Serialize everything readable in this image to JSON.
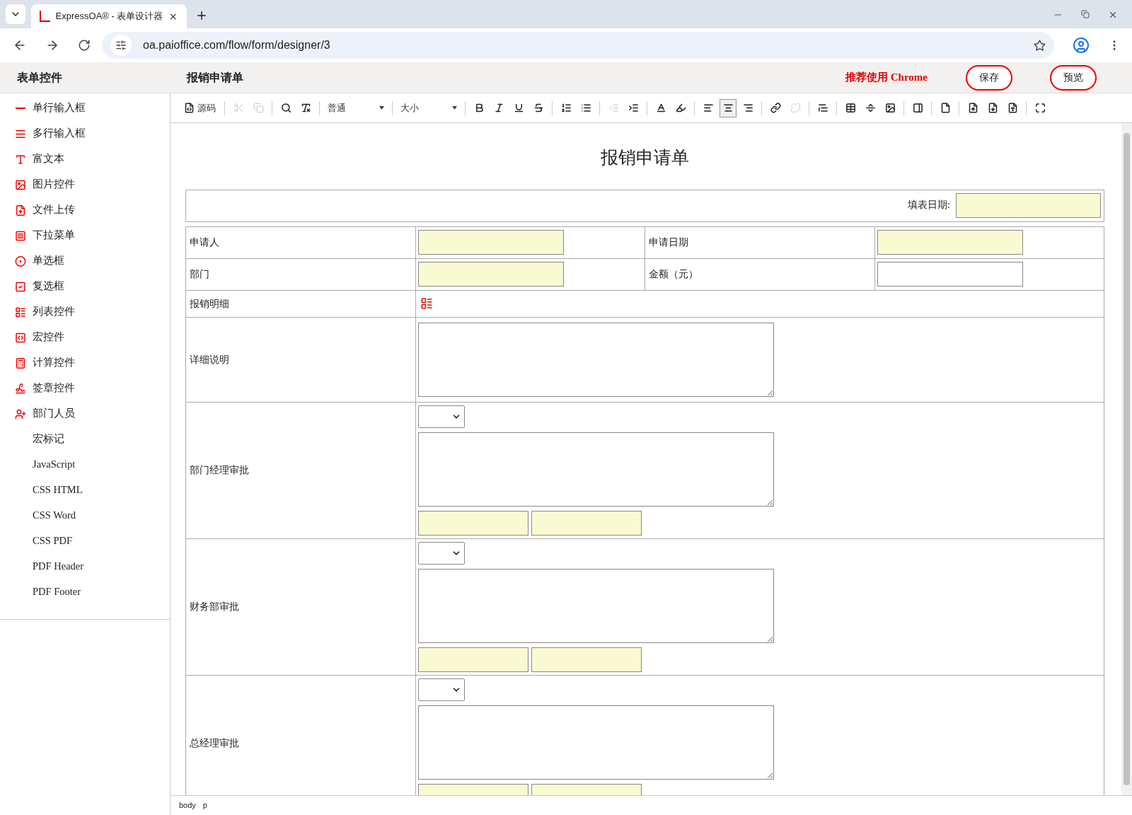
{
  "browser": {
    "tab_title": "ExpressOA® - 表单设计器",
    "url": "oa.paioffice.com/flow/form/designer/3"
  },
  "header": {
    "panel_title": "表单控件",
    "form_title": "报销申请单",
    "notice": "推荐使用 Chrome",
    "buttons": [
      "保存",
      "预览"
    ]
  },
  "sidebar": {
    "items": [
      {
        "label": "单行输入框",
        "kind": "line"
      },
      {
        "label": "多行输入框",
        "kind": "lines"
      },
      {
        "label": "富文本",
        "kind": "richtext"
      },
      {
        "label": "图片控件",
        "kind": "image"
      },
      {
        "label": "文件上传",
        "kind": "upload"
      },
      {
        "label": "下拉菜单",
        "kind": "dropdown"
      },
      {
        "label": "单选框",
        "kind": "radio"
      },
      {
        "label": "复选框",
        "kind": "checkbox"
      },
      {
        "label": "列表控件",
        "kind": "list"
      },
      {
        "label": "宏控件",
        "kind": "macro"
      },
      {
        "label": "计算控件",
        "kind": "calc"
      },
      {
        "label": "签章控件",
        "kind": "sign"
      },
      {
        "label": "部门人员",
        "kind": "user"
      },
      {
        "label": "宏标记",
        "kind": "text"
      },
      {
        "label": "JavaScript",
        "kind": "text"
      },
      {
        "label": "CSS HTML",
        "kind": "text"
      },
      {
        "label": "CSS Word",
        "kind": "text"
      },
      {
        "label": "CSS PDF",
        "kind": "text"
      },
      {
        "label": "PDF Header",
        "kind": "text"
      },
      {
        "label": "PDF Footer",
        "kind": "text"
      }
    ]
  },
  "toolbar": [
    {
      "kind": "source",
      "label": "源码",
      "disabled": false,
      "selected": false
    },
    {
      "kind": "separator"
    },
    {
      "kind": "cut",
      "disabled": true,
      "selected": false
    },
    {
      "kind": "copy",
      "disabled": true,
      "selected": false
    },
    {
      "kind": "separator"
    },
    {
      "kind": "find",
      "disabled": false,
      "selected": false
    },
    {
      "kind": "clearformat",
      "disabled": false,
      "selected": false
    },
    {
      "kind": "separator"
    },
    {
      "kind": "select",
      "value": "普通"
    },
    {
      "kind": "separator"
    },
    {
      "kind": "select",
      "value": "大小"
    },
    {
      "kind": "separator"
    },
    {
      "kind": "bold",
      "disabled": false,
      "selected": false
    },
    {
      "kind": "italic",
      "disabled": false,
      "selected": false
    },
    {
      "kind": "underline",
      "disabled": false,
      "selected": false
    },
    {
      "kind": "strike",
      "disabled": false,
      "selected": false
    },
    {
      "kind": "separator"
    },
    {
      "kind": "ol",
      "disabled": false,
      "selected": false
    },
    {
      "kind": "ul",
      "disabled": false,
      "selected": false
    },
    {
      "kind": "separator"
    },
    {
      "kind": "outdent",
      "disabled": true,
      "selected": false
    },
    {
      "kind": "indent",
      "disabled": false,
      "selected": false
    },
    {
      "kind": "separator"
    },
    {
      "kind": "textcolor",
      "disabled": false,
      "selected": false
    },
    {
      "kind": "bgcolor",
      "disabled": false,
      "selected": false
    },
    {
      "kind": "separator"
    },
    {
      "kind": "alignleft",
      "disabled": false,
      "selected": false
    },
    {
      "kind": "aligncenter",
      "disabled": false,
      "selected": true
    },
    {
      "kind": "alignright",
      "disabled": false,
      "selected": false
    },
    {
      "kind": "separator"
    },
    {
      "kind": "link",
      "disabled": false,
      "selected": false
    },
    {
      "kind": "unlink",
      "disabled": true,
      "selected": false
    },
    {
      "kind": "separator"
    },
    {
      "kind": "blockquote",
      "disabled": false,
      "selected": false
    },
    {
      "kind": "separator"
    },
    {
      "kind": "table",
      "disabled": false,
      "selected": false
    },
    {
      "kind": "hr",
      "disabled": false,
      "selected": false
    },
    {
      "kind": "image",
      "disabled": false,
      "selected": false
    },
    {
      "kind": "separator"
    },
    {
      "kind": "iframe",
      "disabled": false,
      "selected": false
    },
    {
      "kind": "separator"
    },
    {
      "kind": "pagebreak",
      "disabled": false,
      "selected": false
    },
    {
      "kind": "separator"
    },
    {
      "kind": "wordup",
      "disabled": false,
      "selected": false
    },
    {
      "kind": "worddown",
      "disabled": false,
      "selected": false
    },
    {
      "kind": "pdf",
      "disabled": false,
      "selected": false
    },
    {
      "kind": "separator"
    },
    {
      "kind": "maximize",
      "disabled": false,
      "selected": false
    }
  ],
  "form": {
    "title": "报销申请单",
    "date_label": "填表日期:",
    "date_field": {
      "highlighted": true
    },
    "pairs": [
      {
        "label": "申请人",
        "field": {
          "highlighted": true
        },
        "label2": "申请日期",
        "field2": {
          "highlighted": true
        }
      },
      {
        "label": "部门",
        "field": {
          "highlighted": true
        },
        "label2": "金额（元）",
        "field2": {
          "highlighted": false
        }
      }
    ],
    "detail_label": "报销明细",
    "description_label": "详细说明",
    "approvals": [
      {
        "label": "部门经理审批",
        "fields": [
          {
            "highlighted": true
          },
          {
            "highlighted": true
          }
        ]
      },
      {
        "label": "财务部审批",
        "fields": [
          {
            "highlighted": true
          },
          {
            "highlighted": true
          }
        ]
      },
      {
        "label": "总经理审批",
        "fields": [
          {
            "highlighted": true
          },
          {
            "highlighted": true
          }
        ]
      }
    ]
  },
  "status_bar": [
    "body",
    "p"
  ]
}
